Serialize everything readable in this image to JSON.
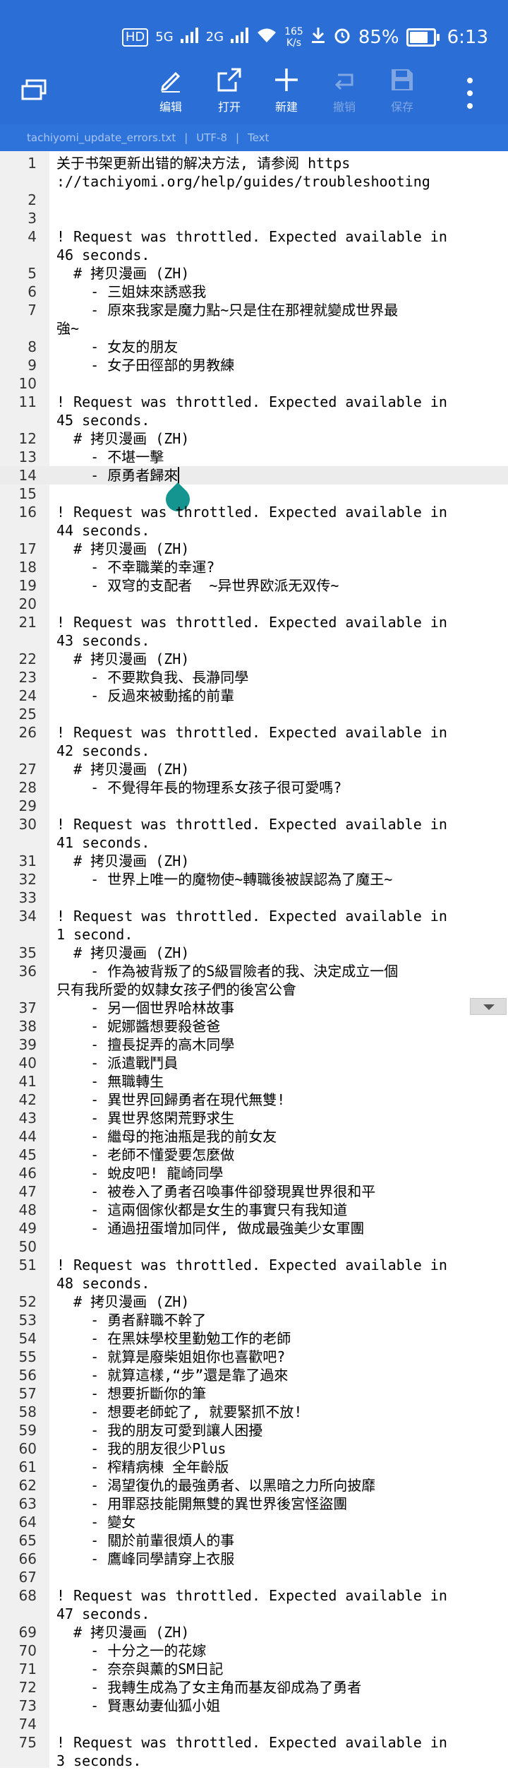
{
  "status_bar": {
    "hd_label": "HD",
    "net1": "5G",
    "net2": "2G",
    "speed_value": "165",
    "speed_unit": "K/s",
    "battery": "85%",
    "time": "6:13"
  },
  "toolbar": {
    "edit": "编辑",
    "open": "打开",
    "new": "新建",
    "undo": "撤销",
    "save": "保存"
  },
  "file_info": {
    "filename": "tachiyomi_update_errors.txt",
    "encoding": "UTF-8",
    "mode": "Text"
  },
  "editor": {
    "current_line": 14,
    "lines": [
      {
        "num": "1",
        "text": "关于书架更新出错的解决方法, 请参阅 https\n://tachiyomi.org/help/guides/troubleshooting"
      },
      {
        "num": "2",
        "text": ""
      },
      {
        "num": "3",
        "text": ""
      },
      {
        "num": "4",
        "text": "! Request was throttled. Expected available in\n46 seconds."
      },
      {
        "num": "5",
        "text": "  # 拷贝漫画 (ZH)"
      },
      {
        "num": "6",
        "text": "    - 三姐妹來誘惑我"
      },
      {
        "num": "7",
        "text": "    - 原來我家是魔力點~只是住在那裡就變成世界最\n強~"
      },
      {
        "num": "8",
        "text": "    - 女友的朋友"
      },
      {
        "num": "9",
        "text": "    - 女子田徑部的男教練"
      },
      {
        "num": "10",
        "text": ""
      },
      {
        "num": "11",
        "text": "! Request was throttled. Expected available in\n45 seconds."
      },
      {
        "num": "12",
        "text": "  # 拷贝漫画 (ZH)"
      },
      {
        "num": "13",
        "text": "    - 不堪一擊"
      },
      {
        "num": "14",
        "text": "    - 原勇者歸來"
      },
      {
        "num": "15",
        "text": ""
      },
      {
        "num": "16",
        "text": "! Request was throttled. Expected available in\n44 seconds."
      },
      {
        "num": "17",
        "text": "  # 拷贝漫画 (ZH)"
      },
      {
        "num": "18",
        "text": "    - 不幸職業的幸運?"
      },
      {
        "num": "19",
        "text": "    - 双穹的支配者  ~异世界欧派无双传~"
      },
      {
        "num": "20",
        "text": ""
      },
      {
        "num": "21",
        "text": "! Request was throttled. Expected available in\n43 seconds."
      },
      {
        "num": "22",
        "text": "  # 拷贝漫画 (ZH)"
      },
      {
        "num": "23",
        "text": "    - 不要欺負我、長瀞同學"
      },
      {
        "num": "24",
        "text": "    - 反過來被動搖的前輩"
      },
      {
        "num": "25",
        "text": ""
      },
      {
        "num": "26",
        "text": "! Request was throttled. Expected available in\n42 seconds."
      },
      {
        "num": "27",
        "text": "  # 拷贝漫画 (ZH)"
      },
      {
        "num": "28",
        "text": "    - 不覺得年長的物理系女孩子很可愛嗎?"
      },
      {
        "num": "29",
        "text": ""
      },
      {
        "num": "30",
        "text": "! Request was throttled. Expected available in\n41 seconds."
      },
      {
        "num": "31",
        "text": "  # 拷贝漫画 (ZH)"
      },
      {
        "num": "32",
        "text": "    - 世界上唯一的魔物使~轉職後被誤認為了魔王~"
      },
      {
        "num": "33",
        "text": ""
      },
      {
        "num": "34",
        "text": "! Request was throttled. Expected available in\n1 second."
      },
      {
        "num": "35",
        "text": "  # 拷贝漫画 (ZH)"
      },
      {
        "num": "36",
        "text": "    - 作為被背叛了的S級冒險者的我、決定成立一個\n只有我所愛的奴隸女孩子們的後宮公會"
      },
      {
        "num": "37",
        "text": "    - 另一個世界哈林故事"
      },
      {
        "num": "38",
        "text": "    - 妮娜醬想要殺爸爸"
      },
      {
        "num": "39",
        "text": "    - 擅長捉弄的高木同學"
      },
      {
        "num": "40",
        "text": "    - 派遣戰鬥員"
      },
      {
        "num": "41",
        "text": "    - 無職轉生"
      },
      {
        "num": "42",
        "text": "    - 異世界回歸勇者在現代無雙!"
      },
      {
        "num": "43",
        "text": "    - 異世界悠閑荒野求生"
      },
      {
        "num": "44",
        "text": "    - 繼母的拖油瓶是我的前女友"
      },
      {
        "num": "45",
        "text": "    - 老師不懂愛要怎麼做"
      },
      {
        "num": "46",
        "text": "    - 蛻皮吧! 龍崎同學"
      },
      {
        "num": "47",
        "text": "    - 被卷入了勇者召喚事件卻發現異世界很和平"
      },
      {
        "num": "48",
        "text": "    - 這兩個傢伙都是女生的事實只有我知道"
      },
      {
        "num": "49",
        "text": "    - 通過扭蛋增加同伴, 做成最強美少女軍團"
      },
      {
        "num": "50",
        "text": ""
      },
      {
        "num": "51",
        "text": "! Request was throttled. Expected available in\n48 seconds."
      },
      {
        "num": "52",
        "text": "  # 拷贝漫画 (ZH)"
      },
      {
        "num": "53",
        "text": "    - 勇者辭職不幹了"
      },
      {
        "num": "54",
        "text": "    - 在黑妹學校里勤勉工作的老師"
      },
      {
        "num": "55",
        "text": "    - 就算是廢柴姐姐你也喜歡吧?"
      },
      {
        "num": "56",
        "text": "    - 就算這樣,“步”還是靠了過來"
      },
      {
        "num": "57",
        "text": "    - 想要折斷你的筆"
      },
      {
        "num": "58",
        "text": "    - 想要老師蛇了, 就要緊抓不放!"
      },
      {
        "num": "59",
        "text": "    - 我的朋友可愛到讓人困擾"
      },
      {
        "num": "60",
        "text": "    - 我的朋友很少Plus"
      },
      {
        "num": "61",
        "text": "    - 榨精病棟 全年齡版"
      },
      {
        "num": "62",
        "text": "    - 渴望復仇的最強勇者、以黑暗之力所向披靡"
      },
      {
        "num": "63",
        "text": "    - 用罪惡技能開無雙的異世界後宮怪盜團"
      },
      {
        "num": "64",
        "text": "    - 變女"
      },
      {
        "num": "65",
        "text": "    - 關於前輩很煩人的事"
      },
      {
        "num": "66",
        "text": "    - 鷹峰同學請穿上衣服"
      },
      {
        "num": "67",
        "text": ""
      },
      {
        "num": "68",
        "text": "! Request was throttled. Expected available in\n47 seconds."
      },
      {
        "num": "69",
        "text": "  # 拷贝漫画 (ZH)"
      },
      {
        "num": "70",
        "text": "    - 十分之一的花嫁"
      },
      {
        "num": "71",
        "text": "    - 奈奈與薰的SM日記"
      },
      {
        "num": "72",
        "text": "    - 我轉生成為了女主角而基友卻成為了勇者"
      },
      {
        "num": "73",
        "text": "    - 賢惠幼妻仙狐小姐"
      },
      {
        "num": "74",
        "text": ""
      },
      {
        "num": "75",
        "text": "! Request was throttled. Expected available in\n3 seconds."
      }
    ]
  }
}
